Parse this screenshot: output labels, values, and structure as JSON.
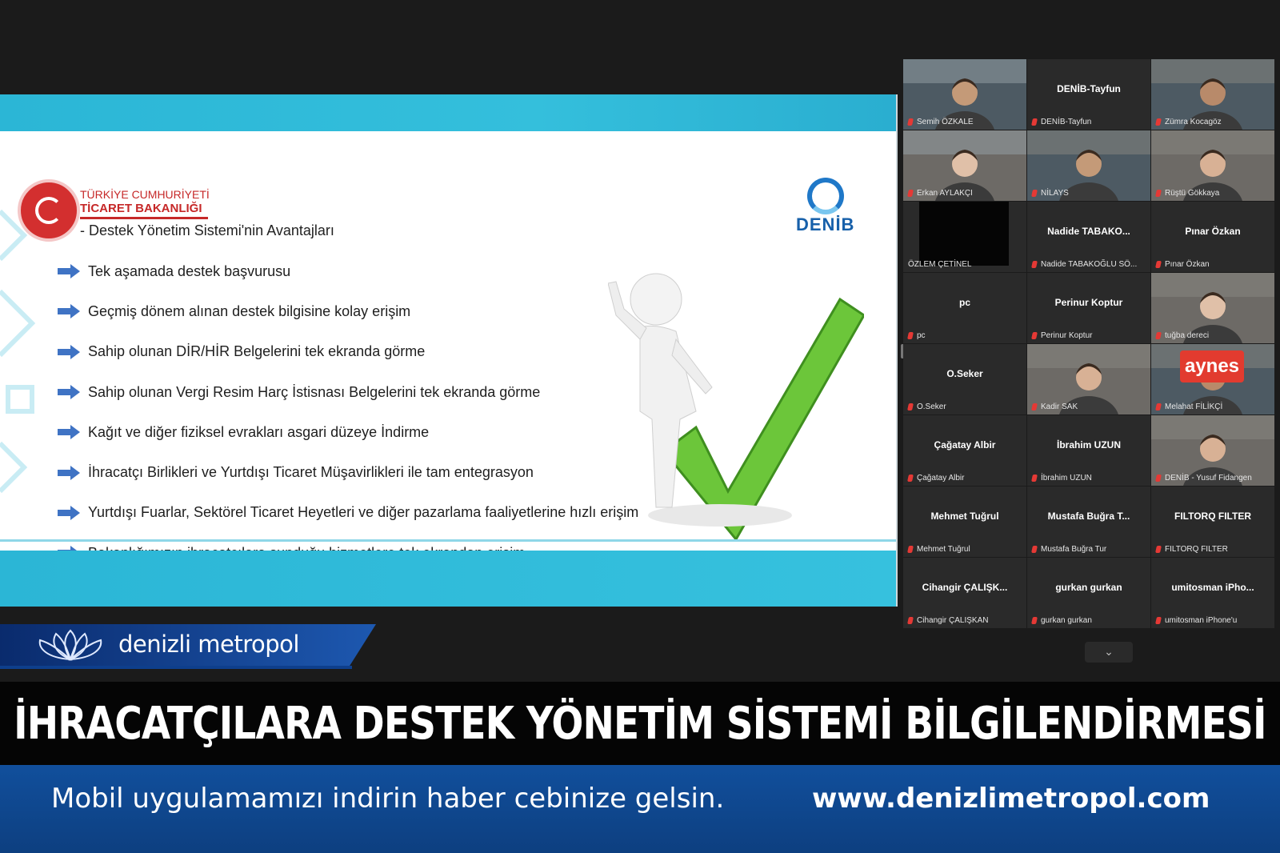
{
  "slide": {
    "ministry_line1": "TÜRKİYE CUMHURİYETİ",
    "ministry_line2": "TİCARET BAKANLIĞI",
    "subtitle": "- Destek Yönetim Sistemi'nin Avantajları",
    "denib_logo": "DENİB",
    "bullets": [
      "Tek aşamada destek başvurusu",
      "Geçmiş dönem alınan destek bilgisine kolay erişim",
      "Sahip olunan DİR/HİR Belgelerini tek ekranda görme",
      "Sahip olunan Vergi Resim Harç İstisnası Belgelerini tek ekranda görme",
      "Kağıt ve diğer fiziksel evrakları asgari düzeye İndirme",
      "İhracatçı Birlikleri ve Yurtdışı Ticaret Müşavirlikleri ile tam entegrasyon",
      "Yurtdışı Fuarlar, Sektörel Ticaret Heyetleri ve diğer pazarlama faaliyetlerine hızlı erişim",
      "Bakanlığımızın ihracatçılara sunduğu hizmetlere tek ekrandan erişim"
    ]
  },
  "participants": [
    {
      "label": "Semih ÖZKALE",
      "center": "",
      "video": true,
      "active": true
    },
    {
      "label": "DENİB-Tayfun",
      "center": "DENİB-Tayfun",
      "video": false
    },
    {
      "label": "Zümra Kocagöz",
      "center": "",
      "video": true
    },
    {
      "label": "Erkan AYLAKÇI",
      "center": "",
      "video": true
    },
    {
      "label": "NİLAYS",
      "center": "",
      "video": true
    },
    {
      "label": "Rüştü Gökkaya",
      "center": "",
      "video": true
    },
    {
      "label": "ÖZLEM ÇETİNEL",
      "center": "",
      "video": false
    },
    {
      "label": "Nadide TABAKOĞLU SÖ...",
      "center": "Nadide TABAKO...",
      "video": false
    },
    {
      "label": "Pınar Özkan",
      "center": "Pınar Özkan",
      "video": false
    },
    {
      "label": "pc",
      "center": "pc",
      "video": false
    },
    {
      "label": "Perinur Koptur",
      "center": "Perinur Koptur",
      "video": false
    },
    {
      "label": "tuğba dereci",
      "center": "",
      "video": true
    },
    {
      "label": "O.Seker",
      "center": "O.Seker",
      "video": false
    },
    {
      "label": "Kadir SAK",
      "center": "",
      "video": true
    },
    {
      "label": "Melahat FİLİKÇİ",
      "center": "",
      "video": true
    },
    {
      "label": "Çağatay Albir",
      "center": "Çağatay Albir",
      "video": false
    },
    {
      "label": "İbrahim UZUN",
      "center": "İbrahim UZUN",
      "video": false
    },
    {
      "label": "DENİB - Yusuf Fidangen",
      "center": "",
      "video": true
    },
    {
      "label": "Mehmet Tuğrul",
      "center": "Mehmet Tuğrul",
      "video": false
    },
    {
      "label": "Mustafa Buğra Tur",
      "center": "Mustafa Buğra T...",
      "video": false
    },
    {
      "label": "FILTORQ FILTER",
      "center": "FILTORQ FILTER",
      "video": false
    },
    {
      "label": "Cihangir ÇALIŞKAN",
      "center": "Cihangir ÇALIŞK...",
      "video": false
    },
    {
      "label": "gurkan gurkan",
      "center": "gurkan gurkan",
      "video": false
    },
    {
      "label": "umitosman iPhone'u",
      "center": "umitosman iPho...",
      "video": false
    }
  ],
  "melahat_sign_text": "aynes",
  "brand": {
    "name": "denizli metropol"
  },
  "headline": "İHRACATÇILARA DESTEK YÖNETİM SİSTEMİ BİLGİLENDİRMESİ",
  "footer": {
    "tagline": "Mobil uygulamamızı indirin haber cebinize gelsin.",
    "url": "www.denizlimetropol.com"
  },
  "colors": {
    "slide_band": "#2bb6d6",
    "brand_blue": "#1d58b0",
    "active_speaker": "#cfe63a"
  }
}
